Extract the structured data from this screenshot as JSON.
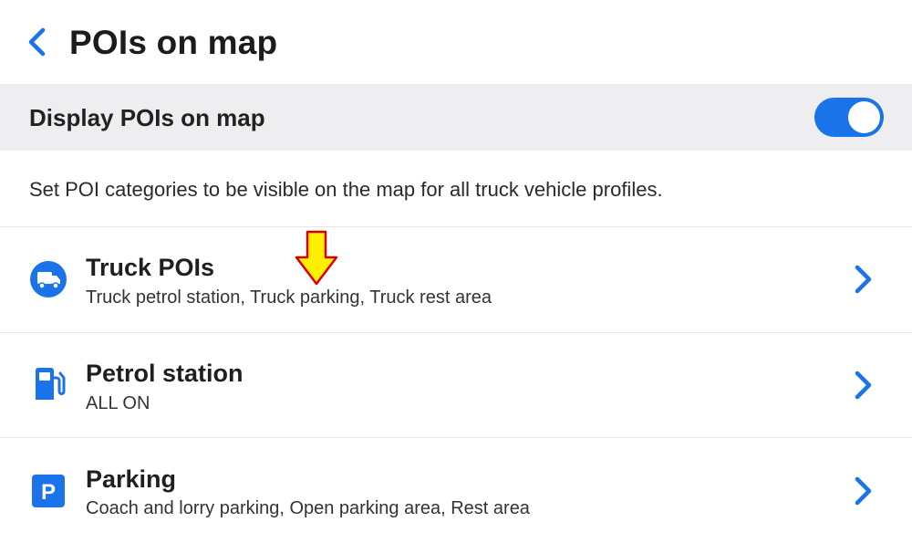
{
  "header": {
    "title": "POIs on map",
    "back_icon": "chevron-left-icon"
  },
  "display_toggle": {
    "label": "Display POIs on map",
    "state": "on",
    "accent_color": "#1a73e8"
  },
  "description": "Set POI categories to be visible on the map for all truck vehicle profiles.",
  "categories": [
    {
      "title": "Truck POIs",
      "subtitle": "Truck petrol station, Truck parking, Truck rest area",
      "icon": "truck-icon"
    },
    {
      "title": "Petrol station",
      "subtitle": "ALL ON",
      "icon": "fuel-pump-icon"
    },
    {
      "title": "Parking",
      "subtitle": "Coach and lorry parking, Open parking area, Rest area",
      "icon": "parking-icon"
    }
  ],
  "colors": {
    "accent": "#1a73e8",
    "toggle_row_bg": "#eeeef0",
    "annotation_fill": "#ffef00",
    "annotation_stroke": "#d40000"
  }
}
